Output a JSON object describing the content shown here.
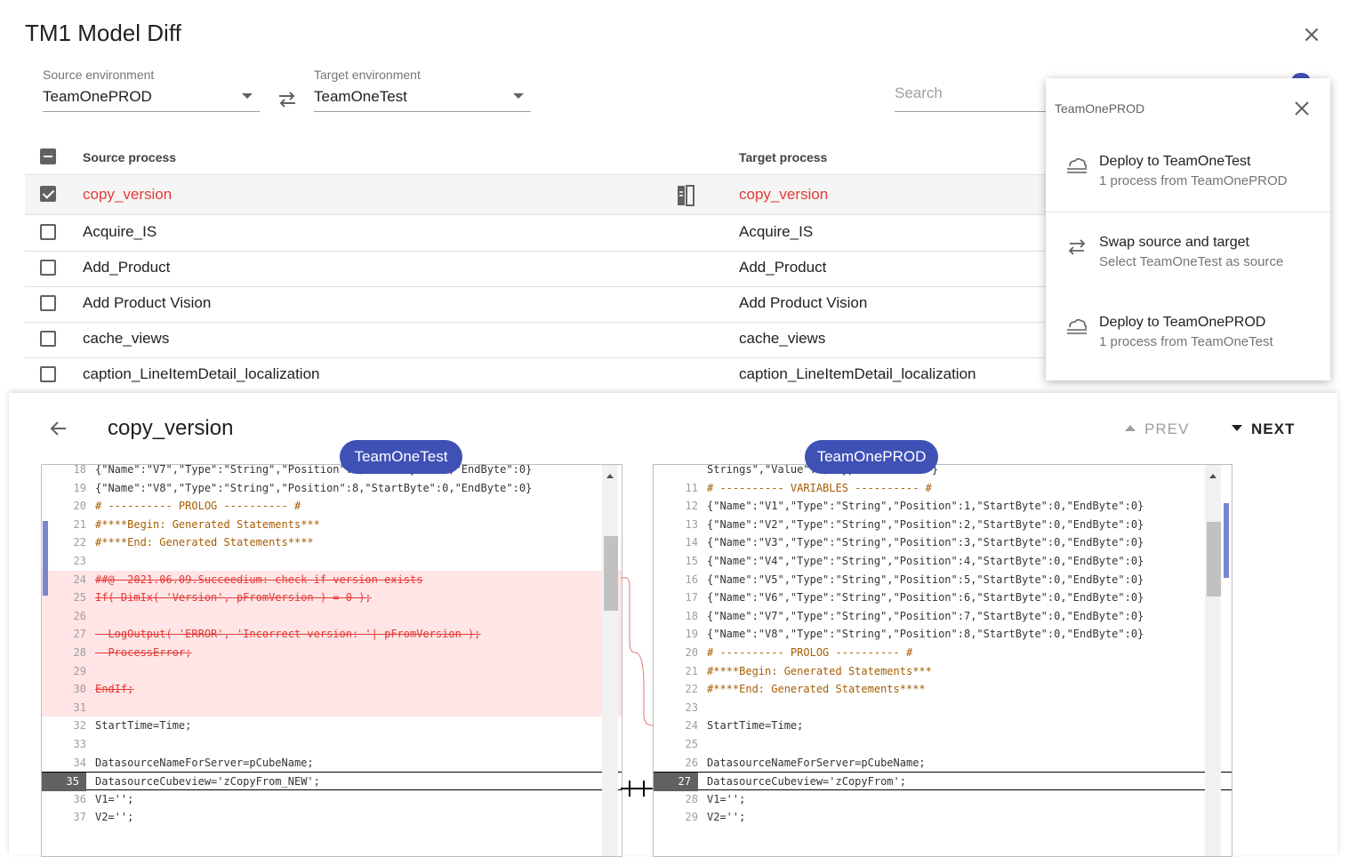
{
  "app": {
    "title": "TM1 Model Diff"
  },
  "source_env": {
    "label": "Source environment",
    "value": "TeamOnePROD"
  },
  "target_env": {
    "label": "Target environment",
    "value": "TeamOneTest"
  },
  "search": {
    "placeholder": "Search"
  },
  "table": {
    "headers": {
      "source": "Source process",
      "target": "Target process"
    },
    "rows": [
      {
        "source": "copy_version",
        "target": "copy_version",
        "checked": true,
        "changed": true
      },
      {
        "source": "Acquire_IS",
        "target": "Acquire_IS",
        "checked": false,
        "changed": false
      },
      {
        "source": "Add_Product",
        "target": "Add_Product",
        "checked": false,
        "changed": false
      },
      {
        "source": "Add Product Vision",
        "target": "Add Product Vision",
        "checked": false,
        "changed": false
      },
      {
        "source": "cache_views",
        "target": "cache_views",
        "checked": false,
        "changed": false
      },
      {
        "source": "caption_LineItemDetail_localization",
        "target": "caption_LineItemDetail_localization",
        "checked": false,
        "changed": false
      }
    ]
  },
  "menu": {
    "header": "TeamOnePROD",
    "items": [
      {
        "title": "Deploy to TeamOneTest",
        "subtitle": "1 process from TeamOnePROD",
        "icon": "cloud-deploy-icon"
      },
      {
        "title": "Swap source and target",
        "subtitle": "Select TeamOneTest as source",
        "icon": "swap-icon"
      },
      {
        "title": "Deploy to TeamOnePROD",
        "subtitle": "1 process from TeamOneTest",
        "icon": "cloud-deploy-icon"
      }
    ]
  },
  "diff": {
    "title": "copy_version",
    "prev_label": "PREV",
    "next_label": "NEXT",
    "left_env": "TeamOneTest",
    "right_env": "TeamOnePROD",
    "left_lines": [
      {
        "n": "18",
        "t": "{\"Name\":\"V7\",\"Type\":\"String\",\"Position\":7,\"StartByte\":0,\"EndByte\":0}",
        "k": ""
      },
      {
        "n": "19",
        "t": "{\"Name\":\"V8\",\"Type\":\"String\",\"Position\":8,\"StartByte\":0,\"EndByte\":0}",
        "k": ""
      },
      {
        "n": "20",
        "t": "# ---------- PROLOG ---------- #",
        "k": "cmt"
      },
      {
        "n": "21",
        "t": "#****Begin: Generated Statements***",
        "k": "cmt"
      },
      {
        "n": "22",
        "t": "#****End: Generated Statements****",
        "k": "cmt"
      },
      {
        "n": "23",
        "t": "",
        "k": ""
      },
      {
        "n": "24",
        "t": "##@  2021.06.09.Succeedium: check if version exists",
        "k": "del"
      },
      {
        "n": "25",
        "t": "If( DimIx( 'Version', pFromVersion ) = 0 );",
        "k": "del"
      },
      {
        "n": "26",
        "t": "",
        "k": "del"
      },
      {
        "n": "27",
        "t": "  LogOutput( 'ERROR', 'Incorrect version: '| pFromVersion );",
        "k": "del"
      },
      {
        "n": "28",
        "t": "  ProcessError;",
        "k": "del"
      },
      {
        "n": "29",
        "t": "",
        "k": "del"
      },
      {
        "n": "30",
        "t": "EndIf;",
        "k": "del"
      },
      {
        "n": "31",
        "t": "",
        "k": "del"
      },
      {
        "n": "32",
        "t": "StartTime=Time;",
        "k": ""
      },
      {
        "n": "33",
        "t": "",
        "k": ""
      },
      {
        "n": "34",
        "t": "DatasourceNameForServer=pCubeName;",
        "k": ""
      },
      {
        "n": "35",
        "t": "DatasourceCubeview='zCopyFrom_NEW';",
        "k": "cur"
      },
      {
        "n": "36",
        "t": "V1='';",
        "k": ""
      },
      {
        "n": "37",
        "t": "V2='';",
        "k": ""
      }
    ],
    "right_lines": [
      {
        "n": "",
        "t": "Strings\",\"Value\":4,\"Type\":\"Numeric\"}",
        "k": ""
      },
      {
        "n": "11",
        "t": "# ---------- VARIABLES ---------- #",
        "k": "cmt"
      },
      {
        "n": "12",
        "t": "{\"Name\":\"V1\",\"Type\":\"String\",\"Position\":1,\"StartByte\":0,\"EndByte\":0}",
        "k": ""
      },
      {
        "n": "13",
        "t": "{\"Name\":\"V2\",\"Type\":\"String\",\"Position\":2,\"StartByte\":0,\"EndByte\":0}",
        "k": ""
      },
      {
        "n": "14",
        "t": "{\"Name\":\"V3\",\"Type\":\"String\",\"Position\":3,\"StartByte\":0,\"EndByte\":0}",
        "k": ""
      },
      {
        "n": "15",
        "t": "{\"Name\":\"V4\",\"Type\":\"String\",\"Position\":4,\"StartByte\":0,\"EndByte\":0}",
        "k": ""
      },
      {
        "n": "16",
        "t": "{\"Name\":\"V5\",\"Type\":\"String\",\"Position\":5,\"StartByte\":0,\"EndByte\":0}",
        "k": ""
      },
      {
        "n": "17",
        "t": "{\"Name\":\"V6\",\"Type\":\"String\",\"Position\":6,\"StartByte\":0,\"EndByte\":0}",
        "k": ""
      },
      {
        "n": "18",
        "t": "{\"Name\":\"V7\",\"Type\":\"String\",\"Position\":7,\"StartByte\":0,\"EndByte\":0}",
        "k": ""
      },
      {
        "n": "19",
        "t": "{\"Name\":\"V8\",\"Type\":\"String\",\"Position\":8,\"StartByte\":0,\"EndByte\":0}",
        "k": ""
      },
      {
        "n": "20",
        "t": "# ---------- PROLOG ---------- #",
        "k": "cmt"
      },
      {
        "n": "21",
        "t": "#****Begin: Generated Statements***",
        "k": "cmt"
      },
      {
        "n": "22",
        "t": "#****End: Generated Statements****",
        "k": "cmt"
      },
      {
        "n": "23",
        "t": "",
        "k": ""
      },
      {
        "n": "24",
        "t": "StartTime=Time;",
        "k": ""
      },
      {
        "n": "25",
        "t": "",
        "k": ""
      },
      {
        "n": "26",
        "t": "DatasourceNameForServer=pCubeName;",
        "k": ""
      },
      {
        "n": "27",
        "t": "DatasourceCubeview='zCopyFrom';",
        "k": "cur"
      },
      {
        "n": "28",
        "t": "V1='';",
        "k": ""
      },
      {
        "n": "29",
        "t": "V2='';",
        "k": ""
      }
    ]
  },
  "colors": {
    "accent": "#3f51b5",
    "changed": "#e53935",
    "deleted_bg": "#ffe5e5",
    "comment": "#a55d00"
  }
}
